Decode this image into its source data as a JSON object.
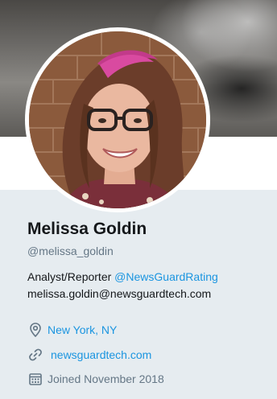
{
  "profile": {
    "name": "Melissa Goldin",
    "handle": "@melissa_goldin",
    "bio_text": "Analyst/Reporter ",
    "bio_mention": "@NewsGuardRating",
    "bio_email": "melissa.goldin@newsguardtech.com",
    "location": "New York, NY",
    "website": "newsguardtech.com",
    "joined": "Joined November 2018"
  },
  "icons": {
    "location": "map-pin-icon",
    "website": "link-icon",
    "joined": "calendar-icon"
  },
  "colors": {
    "link": "#1b95e0",
    "muted": "#657786",
    "text": "#14171a",
    "background": "#e6ecf0"
  }
}
